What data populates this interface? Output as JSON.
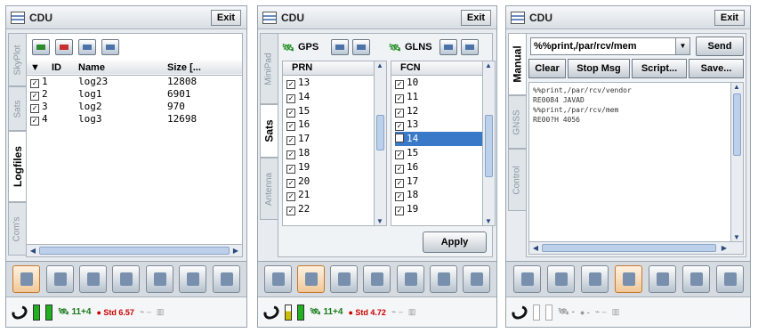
{
  "panel1": {
    "title": "CDU",
    "exit_label": "Exit",
    "tabs": [
      "SkyPlot",
      "Sats",
      "Logfiles",
      "Com's"
    ],
    "active_tab": "Logfiles",
    "toolbar_icons": [
      "new-log-icon",
      "delete-log-icon",
      "edit-log-icon",
      "save-log-icon"
    ],
    "columns": [
      "ID",
      "Name",
      "Size [..."
    ],
    "rows": [
      {
        "id": "1",
        "name": "log23",
        "size": "12808"
      },
      {
        "id": "2",
        "name": "log1",
        "size": "6901"
      },
      {
        "id": "3",
        "name": "log2",
        "size": "970"
      },
      {
        "id": "4",
        "name": "log3",
        "size": "12698"
      }
    ]
  },
  "panel2": {
    "title": "CDU",
    "exit_label": "Exit",
    "tabs": [
      "MiniPad",
      "Sats",
      "Antenna"
    ],
    "active_tab": "Sats",
    "gps_label": "GPS",
    "glns_label": "GLNS",
    "prn_header": "PRN",
    "fcn_header": "FCN",
    "prn": [
      "13",
      "14",
      "15",
      "16",
      "17",
      "18",
      "19",
      "20",
      "21",
      "22"
    ],
    "fcn": [
      {
        "v": "10",
        "checked": true
      },
      {
        "v": "11",
        "checked": true
      },
      {
        "v": "12",
        "checked": true
      },
      {
        "v": "13",
        "checked": true
      },
      {
        "v": "14",
        "checked": false
      },
      {
        "v": "15",
        "checked": true
      },
      {
        "v": "16",
        "checked": true
      },
      {
        "v": "17",
        "checked": true
      },
      {
        "v": "18",
        "checked": true
      },
      {
        "v": "19",
        "checked": true
      }
    ],
    "apply_label": "Apply"
  },
  "panel3": {
    "title": "CDU",
    "exit_label": "Exit",
    "tabs": [
      "Manual",
      "GNSS",
      "Control"
    ],
    "active_tab": "Manual",
    "command_value": "%%print,/par/rcv/mem",
    "send_label": "Send",
    "buttons": [
      "Clear",
      "Stop Msg",
      "Script...",
      "Save..."
    ],
    "output_lines": [
      "%%print,/par/rcv/vendor",
      "RE0084 JAVAD",
      "%%print,/par/rcv/mem",
      "RE00?H 4056"
    ]
  },
  "status": {
    "p1": {
      "sats": "11+4",
      "std_label": "Std",
      "std_value": "6.57"
    },
    "p2": {
      "sats": "11+4",
      "std_label": "Std",
      "std_value": "4.72"
    },
    "p3": {
      "sats": "-",
      "std_label": "-"
    }
  }
}
